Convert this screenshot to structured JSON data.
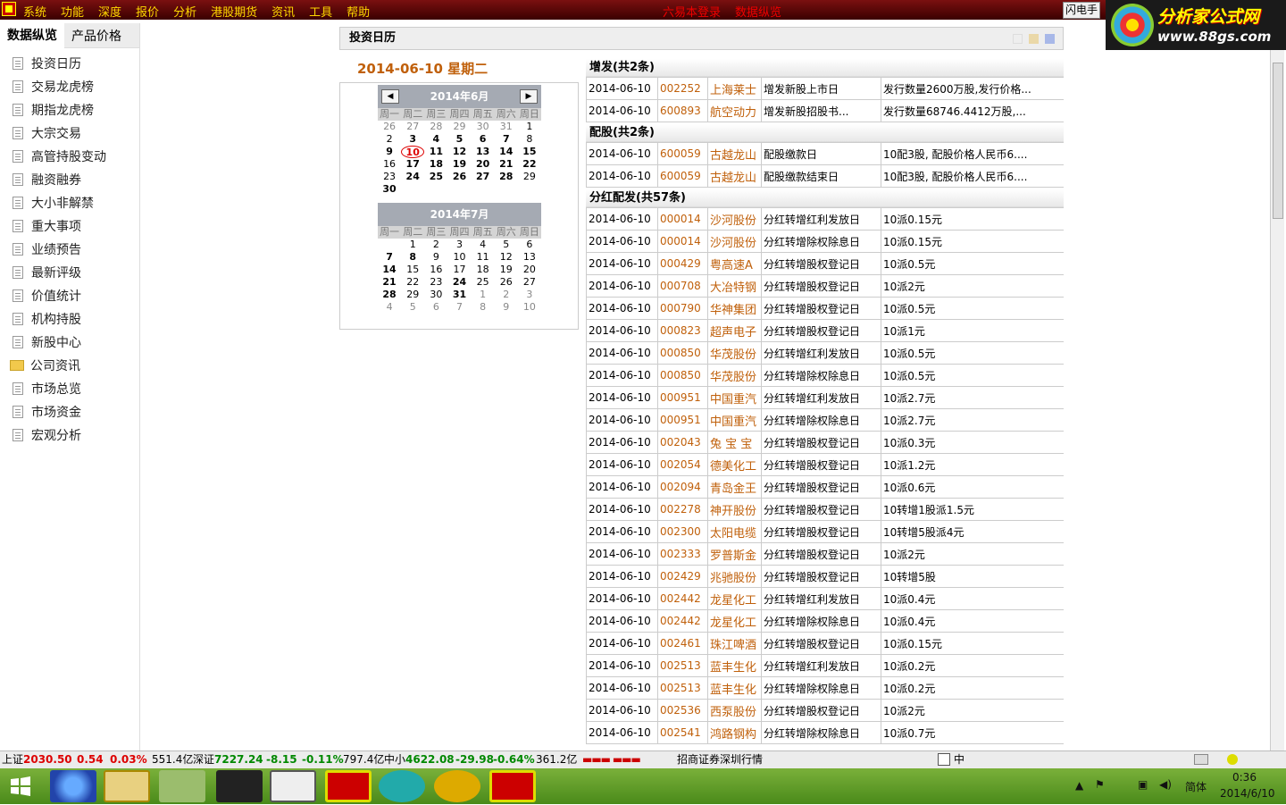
{
  "menubar": {
    "items": [
      "系统",
      "功能",
      "深度",
      "报价",
      "分析",
      "港股期货",
      "资讯",
      "工具",
      "帮助"
    ],
    "center": [
      "六易本登录",
      "数据纵览"
    ],
    "flash_btn": "闪电手"
  },
  "brand": {
    "name": "分析家公式网",
    "url": "www.88gs.com"
  },
  "sidebar": {
    "tabs": [
      "数据纵览",
      "产品价格"
    ],
    "items": [
      "投资日历",
      "交易龙虎榜",
      "期指龙虎榜",
      "大宗交易",
      "高管持股变动",
      "融资融券",
      "大小非解禁",
      "重大事项",
      "业绩预告",
      "最新评级",
      "价值统计",
      "机构持股",
      "新股中心",
      "公司资讯",
      "市场总览",
      "市场资金",
      "宏观分析"
    ]
  },
  "panel": {
    "title": "投资日历",
    "date_heading": "2014-06-10  星期二"
  },
  "calendar": {
    "weekdays": [
      "周一",
      "周二",
      "周三",
      "周四",
      "周五",
      "周六",
      "周日"
    ],
    "june": {
      "title": "2014年6月",
      "days": [
        "26",
        "27",
        "28",
        "29",
        "30",
        "31",
        "1",
        "2",
        "3",
        "4",
        "5",
        "6",
        "7",
        "8",
        "9",
        "10",
        "11",
        "12",
        "13",
        "14",
        "15",
        "16",
        "17",
        "18",
        "19",
        "20",
        "21",
        "22",
        "23",
        "24",
        "25",
        "26",
        "27",
        "28",
        "29",
        "30"
      ]
    },
    "july": {
      "title": "2014年7月",
      "days": [
        "",
        "1",
        "2",
        "3",
        "4",
        "5",
        "6",
        "7",
        "8",
        "9",
        "10",
        "11",
        "12",
        "13",
        "14",
        "15",
        "16",
        "17",
        "18",
        "19",
        "20",
        "21",
        "22",
        "23",
        "24",
        "25",
        "26",
        "27",
        "28",
        "29",
        "30",
        "31",
        "1",
        "2",
        "3",
        "4",
        "5",
        "6",
        "7",
        "8",
        "9",
        "10"
      ]
    }
  },
  "sections": [
    {
      "title": "增发(共2条)",
      "rows": [
        [
          "2014-06-10",
          "002252",
          "上海莱士",
          "增发新股上市日",
          "发行数量2600万股,发行价格..."
        ],
        [
          "2014-06-10",
          "600893",
          "航空动力",
          "增发新股招股书...",
          "发行数量68746.4412万股,..."
        ]
      ]
    },
    {
      "title": "配股(共2条)",
      "rows": [
        [
          "2014-06-10",
          "600059",
          "古越龙山",
          "配股缴款日",
          "10配3股, 配股价格人民币6...."
        ],
        [
          "2014-06-10",
          "600059",
          "古越龙山",
          "配股缴款结束日",
          "10配3股, 配股价格人民币6...."
        ]
      ]
    },
    {
      "title": "分红配发(共57条)",
      "rows": [
        [
          "2014-06-10",
          "000014",
          "沙河股份",
          "分红转增红利发放日",
          "10派0.15元"
        ],
        [
          "2014-06-10",
          "000014",
          "沙河股份",
          "分红转增除权除息日",
          "10派0.15元"
        ],
        [
          "2014-06-10",
          "000429",
          "粤高速A",
          "分红转增股权登记日",
          "10派0.5元"
        ],
        [
          "2014-06-10",
          "000708",
          "大冶特钢",
          "分红转增股权登记日",
          "10派2元"
        ],
        [
          "2014-06-10",
          "000790",
          "华神集团",
          "分红转增股权登记日",
          "10派0.5元"
        ],
        [
          "2014-06-10",
          "000823",
          "超声电子",
          "分红转增股权登记日",
          "10派1元"
        ],
        [
          "2014-06-10",
          "000850",
          "华茂股份",
          "分红转增红利发放日",
          "10派0.5元"
        ],
        [
          "2014-06-10",
          "000850",
          "华茂股份",
          "分红转增除权除息日",
          "10派0.5元"
        ],
        [
          "2014-06-10",
          "000951",
          "中国重汽",
          "分红转增红利发放日",
          "10派2.7元"
        ],
        [
          "2014-06-10",
          "000951",
          "中国重汽",
          "分红转增除权除息日",
          "10派2.7元"
        ],
        [
          "2014-06-10",
          "002043",
          "兔 宝 宝",
          "分红转增股权登记日",
          "10派0.3元"
        ],
        [
          "2014-06-10",
          "002054",
          "德美化工",
          "分红转增股权登记日",
          "10派1.2元"
        ],
        [
          "2014-06-10",
          "002094",
          "青岛金王",
          "分红转增股权登记日",
          "10派0.6元"
        ],
        [
          "2014-06-10",
          "002278",
          "神开股份",
          "分红转增股权登记日",
          "10转增1股派1.5元"
        ],
        [
          "2014-06-10",
          "002300",
          "太阳电缆",
          "分红转增股权登记日",
          "10转增5股派4元"
        ],
        [
          "2014-06-10",
          "002333",
          "罗普斯金",
          "分红转增股权登记日",
          "10派2元"
        ],
        [
          "2014-06-10",
          "002429",
          "兆驰股份",
          "分红转增股权登记日",
          "10转增5股"
        ],
        [
          "2014-06-10",
          "002442",
          "龙星化工",
          "分红转增红利发放日",
          "10派0.4元"
        ],
        [
          "2014-06-10",
          "002442",
          "龙星化工",
          "分红转增除权除息日",
          "10派0.4元"
        ],
        [
          "2014-06-10",
          "002461",
          "珠江啤酒",
          "分红转增股权登记日",
          "10派0.15元"
        ],
        [
          "2014-06-10",
          "002513",
          "蓝丰生化",
          "分红转增红利发放日",
          "10派0.2元"
        ],
        [
          "2014-06-10",
          "002513",
          "蓝丰生化",
          "分红转增除权除息日",
          "10派0.2元"
        ],
        [
          "2014-06-10",
          "002536",
          "西泵股份",
          "分红转增股权登记日",
          "10派2元"
        ],
        [
          "2014-06-10",
          "002541",
          "鸿路钢构",
          "分红转增除权除息日",
          "10派0.7元"
        ]
      ]
    }
  ],
  "status": {
    "sh_label": "上证",
    "sh_val": "2030.50",
    "sh_chg": "0.54",
    "sh_pct": "0.03%",
    "sh_amt": "551.4亿",
    "sz_label": "深证",
    "sz_val": "7227.24",
    "sz_chg": "-8.15",
    "sz_pct": "-0.11%",
    "sz_amt": "797.4亿",
    "zx_label": "中小",
    "zx_val": "4622.08",
    "zx_chg": "-29.98",
    "zx_pct": "-0.64%",
    "zx_amt": "361.2亿",
    "broker": "招商证券深圳行情",
    "ime_mode": "中"
  },
  "taskbar": {
    "time": "0:36",
    "date": "2014/6/10",
    "lang": "简体"
  }
}
